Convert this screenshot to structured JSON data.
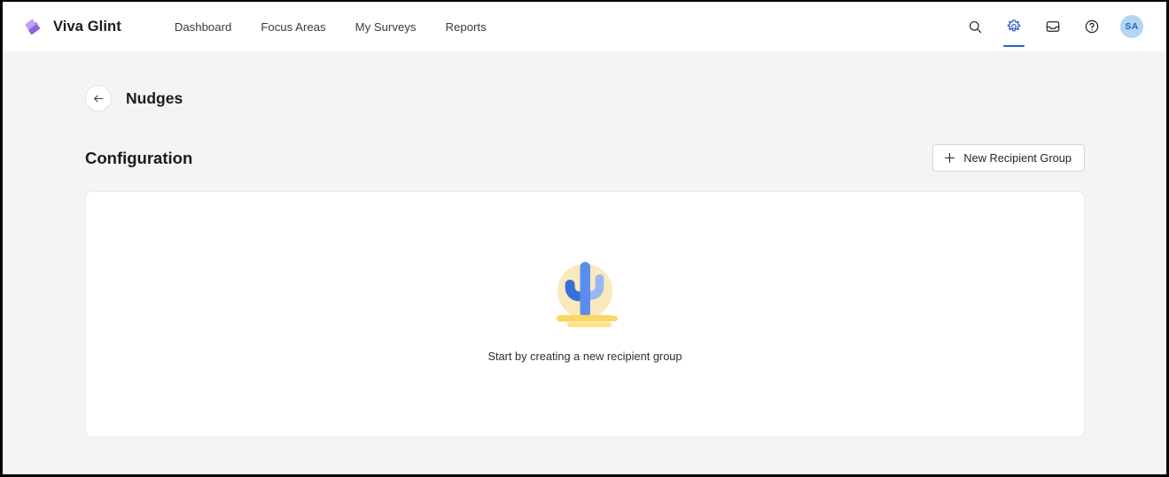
{
  "brand": {
    "name": "Viva Glint",
    "logo_icon": "viva-glint-diamond-icon",
    "logo_colors": {
      "light": "#c79df0",
      "mid": "#a86fe0",
      "dark": "#7b5ad4"
    }
  },
  "nav": {
    "items": [
      {
        "label": "Dashboard"
      },
      {
        "label": "Focus Areas"
      },
      {
        "label": "My Surveys"
      },
      {
        "label": "Reports"
      }
    ]
  },
  "topbar_actions": {
    "search": {
      "icon": "search-icon",
      "label": "Search"
    },
    "settings": {
      "icon": "gear-icon",
      "label": "Settings",
      "active": true,
      "accent": "#2b5fc4"
    },
    "inbox": {
      "icon": "inbox-icon",
      "label": "Inbox"
    },
    "help": {
      "icon": "help-circle-icon",
      "label": "Help"
    },
    "avatar": {
      "initials": "SA",
      "bg": "#b4d6f0",
      "fg": "#2b5fc4"
    }
  },
  "page": {
    "back_icon": "arrow-left-icon",
    "title": "Nudges"
  },
  "section": {
    "title": "Configuration",
    "new_group_button": {
      "label": "New Recipient Group",
      "icon": "plus-icon"
    }
  },
  "empty_state": {
    "illustration": "cactus-desert-icon",
    "message": "Start by creating a new recipient group",
    "colors": {
      "sun": "#fbe9bd",
      "cactus_main": "#5b8def",
      "cactus_left_arm": "#3a6fd8",
      "cactus_right_arm": "#96b8f5",
      "sand": "#fcd663",
      "sand_light": "#fde08a"
    }
  }
}
